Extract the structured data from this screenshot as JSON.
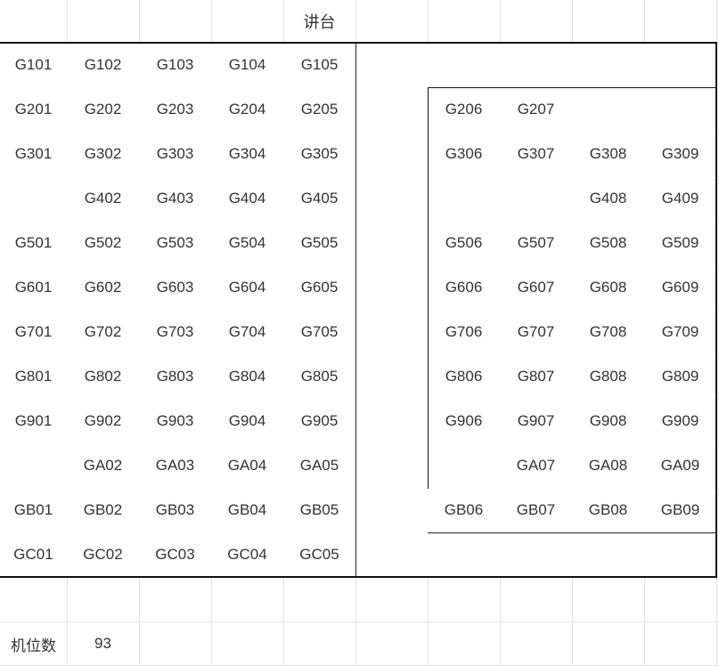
{
  "sheet": {
    "title": "讲台",
    "footer": {
      "label": "机位数",
      "value": "93"
    }
  },
  "left_block": [
    [
      "G101",
      "G102",
      "G103",
      "G104",
      "G105"
    ],
    [
      "G201",
      "G202",
      "G203",
      "G204",
      "G205"
    ],
    [
      "G301",
      "G302",
      "G303",
      "G304",
      "G305"
    ],
    [
      "",
      "G402",
      "G403",
      "G404",
      "G405"
    ],
    [
      "G501",
      "G502",
      "G503",
      "G504",
      "G505"
    ],
    [
      "G601",
      "G602",
      "G603",
      "G604",
      "G605"
    ],
    [
      "G701",
      "G702",
      "G703",
      "G704",
      "G705"
    ],
    [
      "G801",
      "G802",
      "G803",
      "G804",
      "G805"
    ],
    [
      "G901",
      "G902",
      "G903",
      "G904",
      "G905"
    ],
    [
      "",
      "GA02",
      "GA03",
      "GA04",
      "GA05"
    ],
    [
      "GB01",
      "GB02",
      "GB03",
      "GB04",
      "GB05"
    ],
    [
      "GC01",
      "GC02",
      "GC03",
      "GC04",
      "GC05"
    ]
  ],
  "right_block": [
    [
      "G206",
      "G207",
      "",
      ""
    ],
    [
      "G306",
      "G307",
      "G308",
      "G309"
    ],
    [
      "",
      "",
      "G408",
      "G409"
    ],
    [
      "G506",
      "G507",
      "G508",
      "G509"
    ],
    [
      "G606",
      "G607",
      "G608",
      "G609"
    ],
    [
      "G706",
      "G707",
      "G708",
      "G709"
    ],
    [
      "G806",
      "G807",
      "G808",
      "G809"
    ],
    [
      "G906",
      "G907",
      "G908",
      "G909"
    ],
    [
      "",
      "GA07",
      "GA08",
      "GA09"
    ],
    [
      "GB06",
      "GB07",
      "GB08",
      "GB09"
    ]
  ]
}
